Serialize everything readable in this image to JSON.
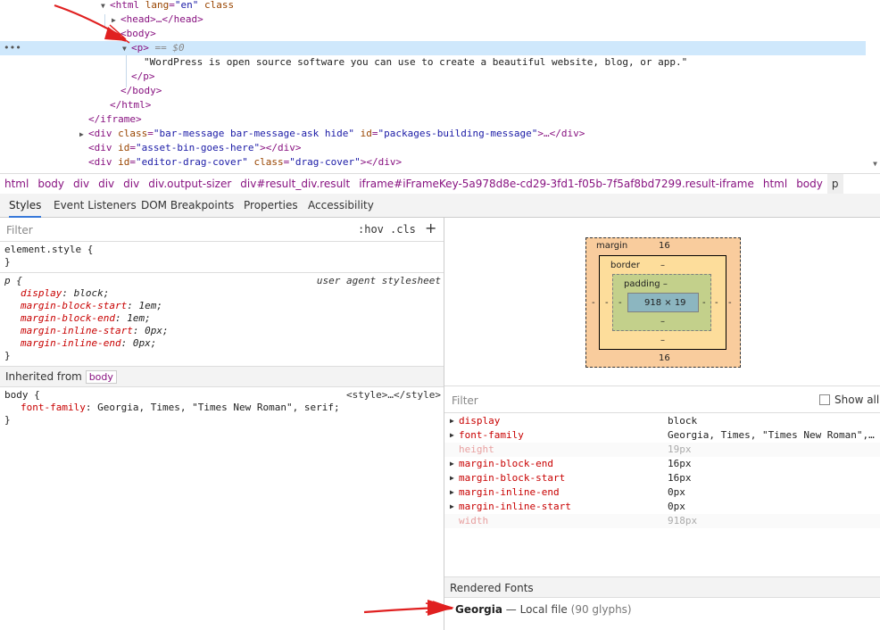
{
  "dom_tree": {
    "lines": [
      {
        "indent": 0,
        "html_open": "html",
        "attr1": "lang",
        "attr1_val": "\"en\"",
        "attr2": "class"
      },
      {
        "indent": 1,
        "head": "<head>…</head>"
      },
      {
        "indent": 1,
        "body": "<body>"
      },
      {
        "p_open": "<p>",
        "marker": "== $0",
        "dots": "•••"
      },
      {
        "text": "\"WordPress is open source software you can use to create a beautiful website, blog, or app.\""
      },
      {
        "p_close": "</p>"
      },
      {
        "body_close": "</body>"
      },
      {
        "html_close": "</html>"
      },
      {
        "iframe_close": "</iframe>"
      },
      {
        "div1": "<div",
        "div1_class_attr": "class",
        "div1_class": "\"bar-message bar-message-ask hide\"",
        "div1_id_attr": "id",
        "div1_id": "\"packages-building-message\"",
        "div1_end": ">…</div>"
      },
      {
        "div2": "<div",
        "div2_id_attr": "id",
        "div2_id": "\"asset-bin-goes-here\"",
        "div2_end": "></div>"
      },
      {
        "div3": "<div",
        "div3_id_attr": "id",
        "div3_id": "\"editor-drag-cover\"",
        "div3_class_attr": "class",
        "div3_class": "\"drag-cover\"",
        "div3_end": "></div>"
      }
    ]
  },
  "breadcrumb": {
    "items": [
      "html",
      "body",
      "div",
      "div",
      "div",
      "div.output-sizer",
      "div#result_div.result",
      "iframe#iFrameKey-5a978d8e-cd29-3fd1-f05b-7f5af8bd7299.result-iframe",
      "html",
      "body",
      "p"
    ]
  },
  "tabs": [
    "Styles",
    "Event Listeners",
    "DOM Breakpoints",
    "Properties",
    "Accessibility"
  ],
  "styles": {
    "filter_placeholder": "Filter",
    "hov": ":hov",
    "cls": ".cls",
    "plus": "+",
    "element_style": "element.style {",
    "close_brace": "}",
    "p_selector": "p {",
    "p_source": "user agent stylesheet",
    "p_props": [
      {
        "name": "display",
        "value": "block;"
      },
      {
        "name": "margin-block-start",
        "value": "1em;"
      },
      {
        "name": "margin-block-end",
        "value": "1em;"
      },
      {
        "name": "margin-inline-start",
        "value": "0px;"
      },
      {
        "name": "margin-inline-end",
        "value": "0px;"
      }
    ],
    "inherited_label": "Inherited from",
    "inherited_tag": "body",
    "body_selector": "body {",
    "body_source": "<style>…</style>",
    "body_prop_name": "font-family",
    "body_prop_value": "Georgia, Times, \"Times New Roman\", serif;"
  },
  "box_model": {
    "margin_label": "margin",
    "margin_top": "16",
    "margin_bottom": "16",
    "margin_left": "-",
    "margin_right": "-",
    "border_label": "border",
    "border_top": "–",
    "border_bottom": "–",
    "border_left": "-",
    "border_right": "-",
    "padding_label": "padding –",
    "padding_bottom": "–",
    "padding_left": "-",
    "padding_right": "-",
    "content": "918 × 19"
  },
  "computed": {
    "filter_placeholder": "Filter",
    "show_all": "Show all",
    "rows": [
      {
        "name": "display",
        "value": "block",
        "dim": false
      },
      {
        "name": "font-family",
        "value": "Georgia, Times, \"Times New Roman\", serif",
        "dim": false
      },
      {
        "name": "height",
        "value": "19px",
        "dim": true
      },
      {
        "name": "margin-block-end",
        "value": "16px",
        "dim": false
      },
      {
        "name": "margin-block-start",
        "value": "16px",
        "dim": false
      },
      {
        "name": "margin-inline-end",
        "value": "0px",
        "dim": false
      },
      {
        "name": "margin-inline-start",
        "value": "0px",
        "dim": false
      },
      {
        "name": "width",
        "value": "918px",
        "dim": true
      }
    ],
    "rendered_fonts_label": "Rendered Fonts",
    "font_name": "Georgia",
    "font_dash": "—",
    "font_source": "Local file",
    "font_glyphs": "(90 glyphs)"
  },
  "colors": {
    "selection": "#cfe8fc",
    "tag": "#881280",
    "attr_name": "#994500",
    "attr_value": "#1a1aa6",
    "property": "#c80000",
    "annotation_arrow": "#e02020"
  },
  "icons": [
    "expand-triangle-icon",
    "collapse-triangle-icon",
    "add-rule-icon",
    "checkbox-icon",
    "red-annotation-arrow-icon"
  ]
}
